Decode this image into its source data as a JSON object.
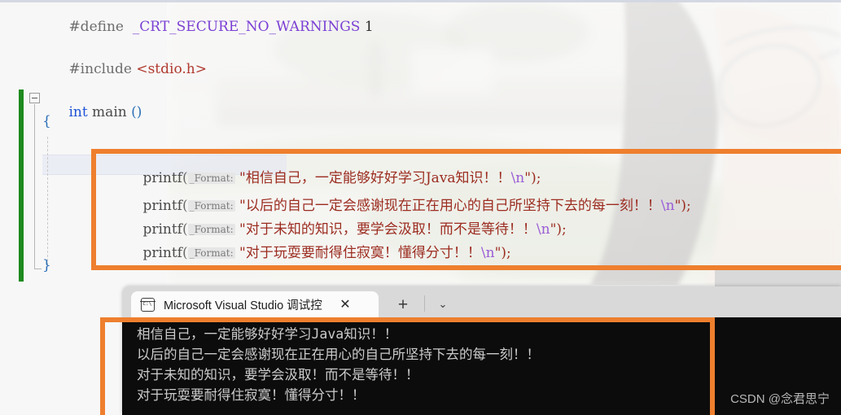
{
  "editor": {
    "lines": [
      {
        "id": "define",
        "tokens": [
          {
            "t": "#define",
            "cls": "t-pp"
          },
          {
            "t": "  ",
            "cls": "t-plain"
          },
          {
            "t": "_CRT_SECURE_NO_WARNINGS",
            "cls": "t-macro"
          },
          {
            "t": " ",
            "cls": "t-plain"
          },
          {
            "t": "1",
            "cls": "t-num"
          }
        ]
      },
      {
        "id": "include",
        "tokens": [
          {
            "t": "#include",
            "cls": "t-pp"
          },
          {
            "t": " ",
            "cls": "t-plain"
          },
          {
            "t": "<stdio.h>",
            "cls": "t-inc"
          }
        ]
      },
      {
        "id": "main",
        "tokens": [
          {
            "t": "int",
            "cls": "t-kw"
          },
          {
            "t": " main ",
            "cls": "t-plain"
          },
          {
            "t": "()",
            "cls": "t-brace"
          }
        ]
      },
      {
        "id": "open-brace",
        "tokens": [
          {
            "t": "{",
            "cls": "t-brace"
          }
        ]
      },
      {
        "id": "close-brace",
        "tokens": [
          {
            "t": "}",
            "cls": "t-brace"
          }
        ]
      }
    ],
    "printf_hint_label": "_Format:",
    "printf_calls": [
      {
        "func": "printf",
        "string": "\"相信自己，一定能够好好学习Java知识！！",
        "escape": "\\n",
        "tail": "\");"
      },
      {
        "func": "printf",
        "string": "\"以后的自己一定会感谢现在正在用心的自己所坚持下去的每一刻！！",
        "escape": "\\n",
        "tail": "\");"
      },
      {
        "func": "printf",
        "string": "\"对于未知的知识，要学会汲取！而不是等待！！",
        "escape": "\\n",
        "tail": "\");"
      },
      {
        "func": "printf",
        "string": "\"对于玩耍要耐得住寂寞！懂得分寸！！",
        "escape": "\\n",
        "tail": "\");"
      }
    ]
  },
  "console": {
    "tab": {
      "title": "Microsoft Visual Studio 调试控",
      "close_label": "✕",
      "new_tab_label": "+",
      "menu_label": "⌄"
    },
    "output_lines": [
      "相信自己，一定能够好好学习Java知识！！",
      "以后的自己一定会感谢现在正在用心的自己所坚持下去的每一刻！！",
      "对于未知的知识，要学会汲取！而不是等待！！",
      "对于玩耍要耐得住寂寞！懂得分寸！！"
    ]
  },
  "watermark": {
    "text": "CSDN @念君思宁"
  },
  "annotations": {
    "accent_color": "#ee7f2e",
    "code_box_name": "printf-block-highlight",
    "console_box_name": "console-output-highlight"
  },
  "colors": {
    "change_bar": "#1d8a1d",
    "console_background": "#0c0c0c",
    "console_text": "#cccccc",
    "macro": "#7b3fd4",
    "string": "#9c2c20",
    "escape": "#9b5cd6",
    "keyword": "#1f52d6",
    "include_path": "#b03a2e"
  }
}
